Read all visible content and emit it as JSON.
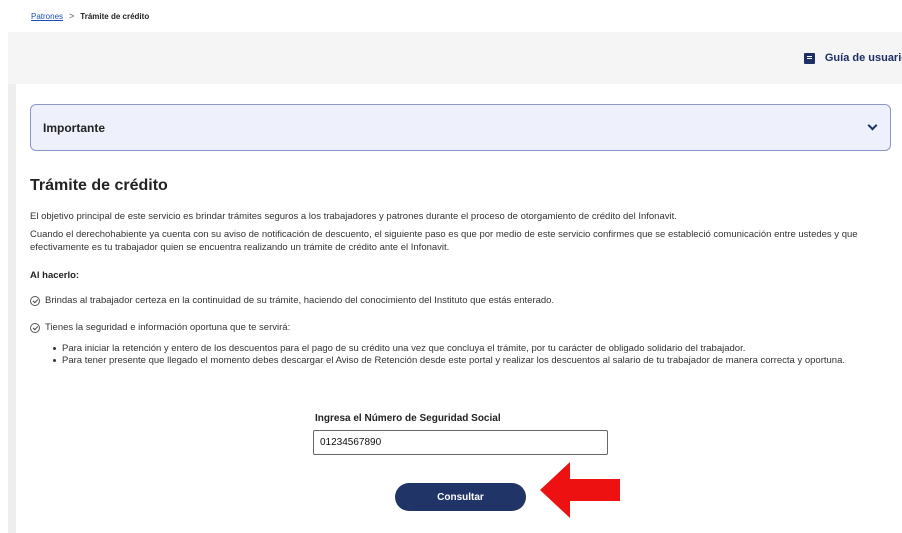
{
  "breadcrumb": {
    "link": "Patrones",
    "separator": ">",
    "current": "Trámite de crédito"
  },
  "header": {
    "guide_label": "Guía de usuario",
    "guide_icon": "book-icon"
  },
  "accordion": {
    "title": "Importante",
    "icon": "chevron-down-icon"
  },
  "main": {
    "title": "Trámite de crédito",
    "paragraph1": "El objetivo principal de este servicio es brindar trámites seguros a los trabajadores y patrones durante el proceso de otorgamiento de crédito del Infonavit.",
    "paragraph2": "Cuando el derechohabiente ya cuenta con su aviso de notificación de descuento, el siguiente paso es que por medio de este servicio confirmes que se estableció comunicación entre ustedes y que efectivamente es tu trabajador quien se encuentra realizando un trámite de crédito ante el Infonavit.",
    "subheading": "Al hacerlo:",
    "check1": "Brindas al trabajador certeza en la continuidad de su trámite, haciendo del conocimiento del Instituto que estás enterado.",
    "check2": "Tienes la seguridad e información oportuna que te servirá:",
    "bullets": [
      "Para iniciar la retención y entero de los descuentos para el pago de su crédito una vez que concluya el trámite, por tu carácter de obligado solidario del trabajador.",
      "Para tener presente que llegado el momento debes descargar el Aviso de Retención desde este portal y realizar los descuentos al salario de tu trabajador de manera correcta y oportuna."
    ]
  },
  "form": {
    "nss_label": "Ingresa el Número de Seguridad Social",
    "nss_value": "01234567890",
    "submit_label": "Consultar"
  },
  "colors": {
    "primary": "#213468",
    "accent_arrow": "#ee1111",
    "accordion_bg": "#eef1fc",
    "link": "#1d4fb8"
  }
}
